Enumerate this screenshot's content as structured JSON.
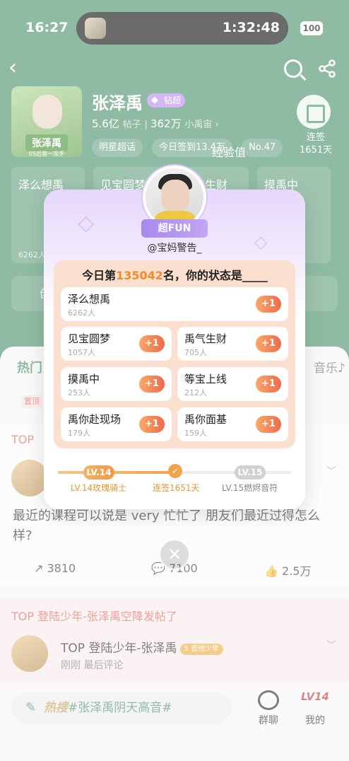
{
  "status_bar": {
    "time": "16:27",
    "timer": "1:32:48",
    "battery": "100"
  },
  "header": {
    "star_name": "张泽禹",
    "super_badge": "钻超",
    "posts_count": "5.6亿",
    "posts_label": "帖子",
    "members_count": "362万",
    "members_label": "小禹宙 ›",
    "cover_name": "张泽禹",
    "cover_sub": "05后第一攻手",
    "chips": [
      "明星超话",
      "今日签到13.4万",
      "No.47"
    ],
    "checkin_label": "连签",
    "checkin_days": "1651天",
    "exp_label": "经验值"
  },
  "background": {
    "task_cards": [
      {
        "name": "泽么想禹",
        "count": "6262人"
      },
      {
        "name": "见宝圆梦",
        "count": ""
      },
      {
        "name": "禹气生财",
        "count": ""
      },
      {
        "name": "摸禹中",
        "count": ""
      }
    ],
    "notice_text": "创",
    "tabs": {
      "hot": "热门",
      "music": "音乐♪"
    },
    "pin_tag": "置顶",
    "post1": {
      "top_label": "TOP",
      "text": "最近的课程可以说是 very 忙忙了 朋友们最近过得怎么样?",
      "reposts": "3810",
      "comments": "7100",
      "likes": "2.5万"
    },
    "post2": {
      "top_label": "TOP 登陆少年-张泽禹空降发帖了",
      "author": "TOP 登陆少年-张泽禹",
      "level_badge": "5 吉他少年",
      "subtext": "刚刚  最后评论"
    },
    "bottom_bar": {
      "hot_prefix": "热搜",
      "hot_topic": "#张泽禹阴天高音#",
      "group_chat": "群聊",
      "mine": "我的",
      "mine_level": "LV14"
    }
  },
  "modal": {
    "fan_badge": "超FUN",
    "fan_handle": "@宝妈警告_",
    "ranking_prefix": "今日第",
    "ranking_number": "135042",
    "ranking_suffix": "名，你的状态是",
    "ranking_blank": "_____",
    "options": [
      {
        "name": "泽么想禹",
        "count": "6262人",
        "action": "+1"
      },
      {
        "name": "见宝圆梦",
        "count": "1057人",
        "action": "+1"
      },
      {
        "name": "禹气生财",
        "count": "705人",
        "action": "+1"
      },
      {
        "name": "摸禹中",
        "count": "253人",
        "action": "+1"
      },
      {
        "name": "等宝上线",
        "count": "212人",
        "action": "+1"
      },
      {
        "name": "禹你赴现场",
        "count": "179人",
        "action": "+1"
      },
      {
        "name": "禹你面基",
        "count": "159人",
        "action": "+1"
      }
    ],
    "level": {
      "current": "LV.14",
      "next": "LV.15",
      "current_caption": "LV.14玫瑰骑士",
      "streak_caption": "连签1651天",
      "next_caption": "LV.15燃烬音符",
      "progress_fraction": 0.5
    },
    "close_symbol": "✕"
  },
  "colors": {
    "brand_green": "#3f8a62",
    "accent_orange": "#f08a2a",
    "fan_purple": "#a58ae9"
  }
}
